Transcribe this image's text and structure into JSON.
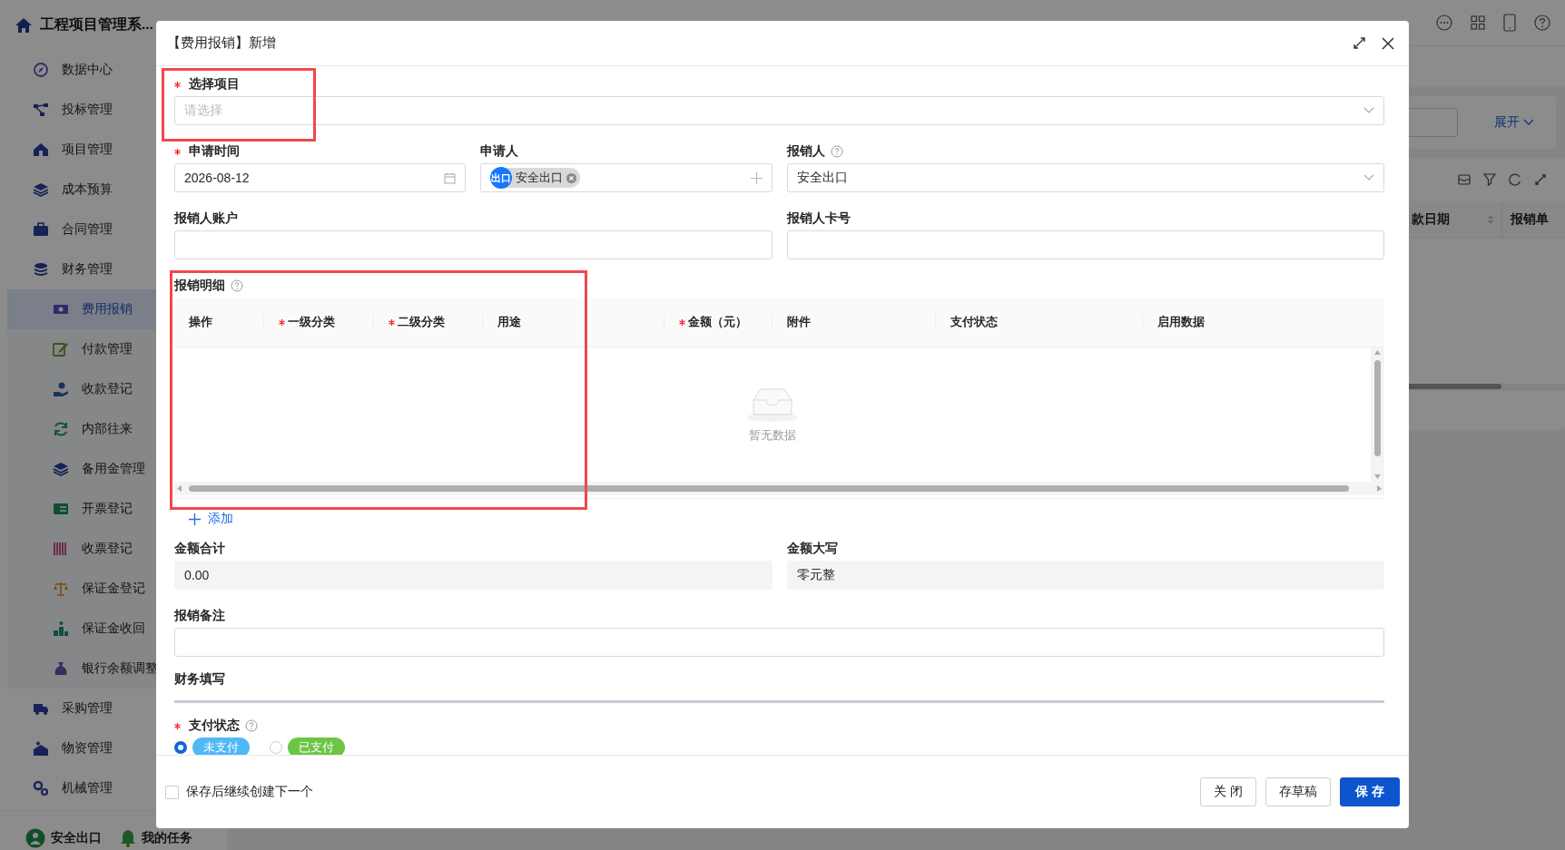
{
  "app": {
    "title": "工程项目管理系..."
  },
  "sidebar": {
    "items": [
      {
        "label": "数据中心",
        "selected": false
      },
      {
        "label": "投标管理",
        "selected": false
      },
      {
        "label": "项目管理",
        "selected": false
      },
      {
        "label": "成本预算",
        "selected": false
      },
      {
        "label": "合同管理",
        "selected": false
      },
      {
        "label": "财务管理",
        "selected": false,
        "children": [
          {
            "label": "费用报销",
            "selected": true
          },
          {
            "label": "付款管理",
            "selected": false
          },
          {
            "label": "收款登记",
            "selected": false
          },
          {
            "label": "内部往来",
            "selected": false
          },
          {
            "label": "备用金管理",
            "selected": false
          },
          {
            "label": "开票登记",
            "selected": false
          },
          {
            "label": "收票登记",
            "selected": false
          },
          {
            "label": "保证金登记",
            "selected": false
          },
          {
            "label": "保证金收回",
            "selected": false
          },
          {
            "label": "银行余额调整",
            "selected": false
          }
        ]
      },
      {
        "label": "采购管理",
        "selected": false
      },
      {
        "label": "物资管理",
        "selected": false
      },
      {
        "label": "机械管理",
        "selected": false
      }
    ],
    "footer": [
      {
        "label": "安全出口"
      },
      {
        "label": "我的任务"
      }
    ]
  },
  "background": {
    "expand_link": "展开",
    "table_columns": [
      "款日期",
      "报销单"
    ]
  },
  "dialog": {
    "title": "【费用报销】新增",
    "project": {
      "label": "选择项目",
      "required": true,
      "help": false,
      "placeholder": "请选择",
      "highlighted": true
    },
    "apply_time": {
      "label": "申请时间",
      "required": true,
      "help": false,
      "value": "2026-08-12"
    },
    "applicant": {
      "label": "申请人",
      "required": false,
      "help": false,
      "tags": [
        {
          "avatar": "出口",
          "name": "安全出口"
        }
      ]
    },
    "reimburser": {
      "label": "报销人",
      "required": false,
      "help": true,
      "value": "安全出口"
    },
    "account": {
      "label": "报销人账户",
      "required": false,
      "help": false
    },
    "card_no": {
      "label": "报销人卡号",
      "required": false,
      "help": false
    },
    "details": {
      "label": "报销明细",
      "required": false,
      "help": true,
      "highlighted": true,
      "columns": [
        {
          "label": "操作",
          "required": false
        },
        {
          "label": "一级分类",
          "required": true
        },
        {
          "label": "二级分类",
          "required": true
        },
        {
          "label": "用途",
          "required": false
        },
        {
          "label": "金额（元）",
          "required": true
        },
        {
          "label": "附件",
          "required": false
        },
        {
          "label": "支付状态",
          "required": false
        },
        {
          "label": "启用数据",
          "required": false
        }
      ],
      "empty_text": "暂无数据",
      "add_link": "添加"
    },
    "total": {
      "label": "金额合计",
      "required": false,
      "help": false,
      "value": "0.00"
    },
    "total_upper": {
      "label": "金额大写",
      "required": false,
      "help": false,
      "value": "零元整"
    },
    "remark": {
      "label": "报销备注",
      "required": false,
      "help": false
    },
    "finance_section": "财务填写",
    "pay_status": {
      "label": "支付状态",
      "required": true,
      "help": true,
      "options": [
        {
          "label": "未支付",
          "selected": true,
          "color": "#4fb8f7"
        },
        {
          "label": "已支付",
          "selected": false,
          "color": "#6cc644"
        }
      ]
    },
    "footer": {
      "continue_checkbox": {
        "label": "保存后继续创建下一个",
        "checked": false
      },
      "buttons": [
        {
          "label": "关 闭",
          "kind": "default"
        },
        {
          "label": "存草稿",
          "kind": "default"
        },
        {
          "label": "保 存",
          "kind": "primary"
        }
      ]
    }
  }
}
